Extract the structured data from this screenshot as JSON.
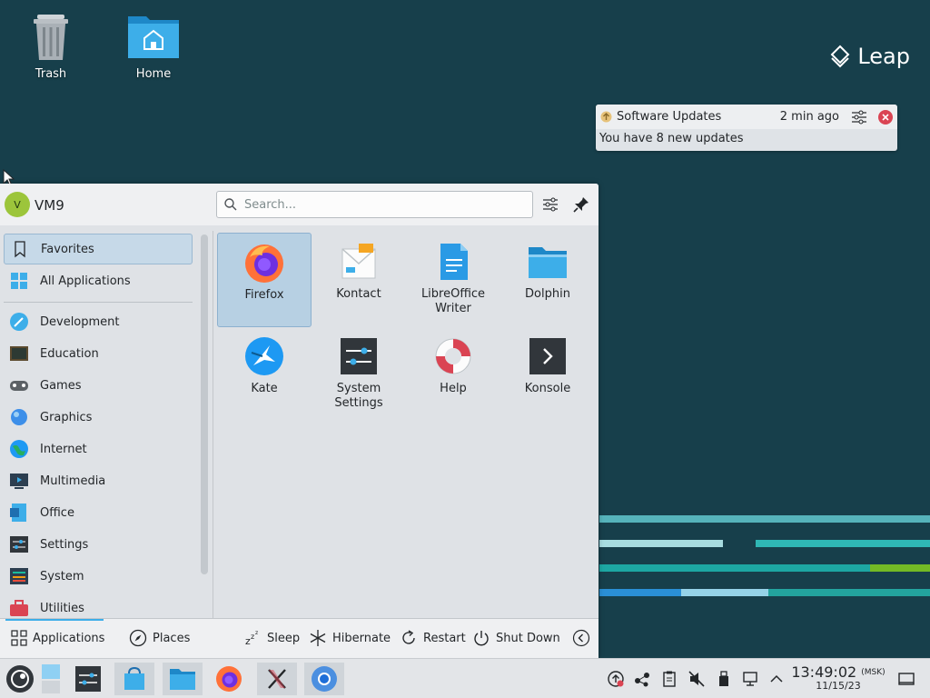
{
  "desktop": {
    "icons": [
      {
        "label": "Trash"
      },
      {
        "label": "Home"
      }
    ],
    "logo_text": "Leap"
  },
  "notification": {
    "app": "Software Updates",
    "time": "2 min ago",
    "body": "You have 8 new updates"
  },
  "menu": {
    "username": "VM9",
    "avatar_letter": "V",
    "search_placeholder": "Search...",
    "sidebar": {
      "items": [
        {
          "label": "Favorites"
        },
        {
          "label": "All Applications"
        },
        {
          "label": "Development"
        },
        {
          "label": "Education"
        },
        {
          "label": "Games"
        },
        {
          "label": "Graphics"
        },
        {
          "label": "Internet"
        },
        {
          "label": "Multimedia"
        },
        {
          "label": "Office"
        },
        {
          "label": "Settings"
        },
        {
          "label": "System"
        },
        {
          "label": "Utilities"
        }
      ]
    },
    "apps": [
      {
        "label": "Firefox"
      },
      {
        "label": "Kontact"
      },
      {
        "label": "LibreOffice\nWriter"
      },
      {
        "label": "Dolphin"
      },
      {
        "label": "Kate"
      },
      {
        "label": "System\nSettings"
      },
      {
        "label": "Help"
      },
      {
        "label": "Konsole"
      }
    ],
    "footer": {
      "applications": "Applications",
      "places": "Places",
      "sleep": "Sleep",
      "hibernate": "Hibernate",
      "restart": "Restart",
      "shutdown": "Shut Down"
    }
  },
  "taskbar": {
    "time": "13:49:02",
    "zone": "(MSK)",
    "date": "11/15/23"
  },
  "colors": {
    "wallpaper": "#173f4b",
    "accent": "#3daee9",
    "selection": "#c6d9e8"
  }
}
